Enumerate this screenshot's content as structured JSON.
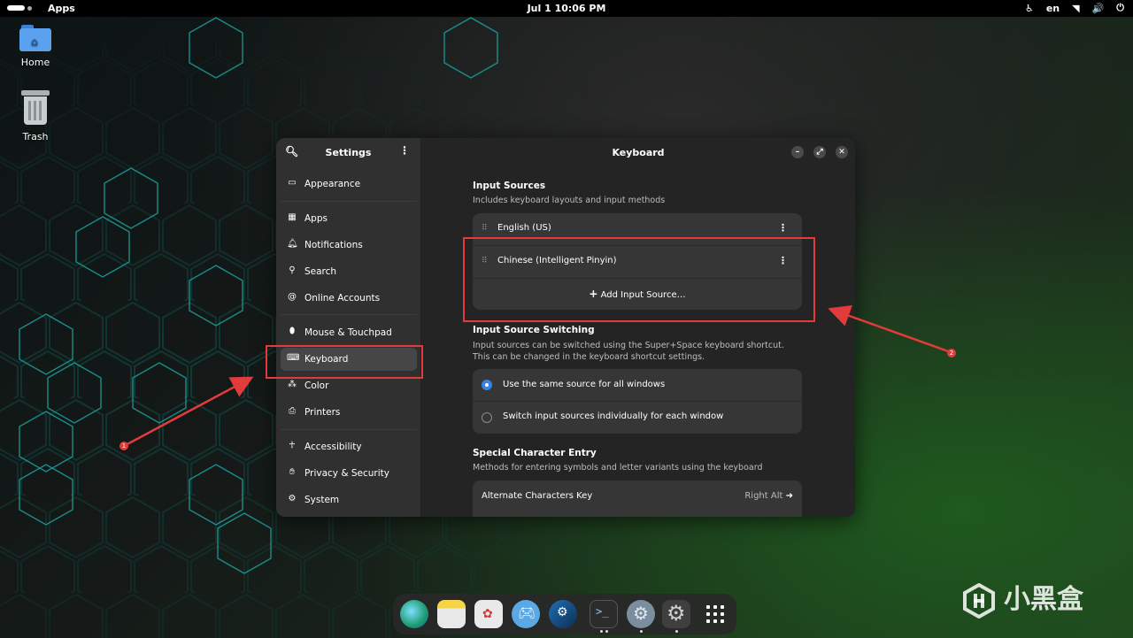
{
  "topbar": {
    "apps_label": "Apps",
    "clock": "Jul 1  10:06 PM",
    "language": "en"
  },
  "desktop": {
    "icons": [
      {
        "label": "Home",
        "icon": "home-folder-icon"
      },
      {
        "label": "Trash",
        "icon": "trash-icon"
      }
    ]
  },
  "sidebar": {
    "title": "Settings",
    "items": [
      {
        "label": "Appearance",
        "icon": "display-icon"
      },
      {
        "label": "Apps",
        "icon": "apps-grid-icon"
      },
      {
        "label": "Notifications",
        "icon": "bell-icon"
      },
      {
        "label": "Search",
        "icon": "search-icon"
      },
      {
        "label": "Online Accounts",
        "icon": "at-sign-icon"
      },
      {
        "label": "Mouse & Touchpad",
        "icon": "mouse-icon"
      },
      {
        "label": "Keyboard",
        "icon": "keyboard-icon",
        "active": true
      },
      {
        "label": "Color",
        "icon": "color-icon"
      },
      {
        "label": "Printers",
        "icon": "printer-icon"
      },
      {
        "label": "Accessibility",
        "icon": "accessibility-icon"
      },
      {
        "label": "Privacy & Security",
        "icon": "hand-icon"
      },
      {
        "label": "System",
        "icon": "gear-icon"
      }
    ]
  },
  "content": {
    "title": "Keyboard",
    "input_sources": {
      "title": "Input Sources",
      "description": "Includes keyboard layouts and input methods",
      "sources": [
        "English (US)",
        "Chinese (Intelligent Pinyin)"
      ],
      "add_label": "Add Input Source…"
    },
    "switching": {
      "title": "Input Source Switching",
      "description_1": "Input sources can be switched using the Super+Space keyboard shortcut.",
      "description_2": "This can be changed in the keyboard shortcut settings.",
      "options": [
        {
          "label": "Use the same source for all windows",
          "selected": true
        },
        {
          "label": "Switch input sources individually for each window",
          "selected": false
        }
      ]
    },
    "special": {
      "title": "Special Character Entry",
      "description": "Methods for entering symbols and letter variants using the keyboard",
      "alt_key_label": "Alternate Characters Key",
      "alt_key_value": "Right Alt"
    }
  },
  "annotations": {
    "marker_1": "1",
    "marker_2": "2",
    "color": "#e23b3b"
  },
  "dock": {
    "items": [
      "browser-icon",
      "files-icon",
      "software-icon",
      "game-controller-icon",
      "steam-icon",
      "terminal-icon",
      "settings-gear-icon",
      "settings-icon",
      "app-grid-icon"
    ]
  },
  "watermark": {
    "text": "小黑盒"
  }
}
